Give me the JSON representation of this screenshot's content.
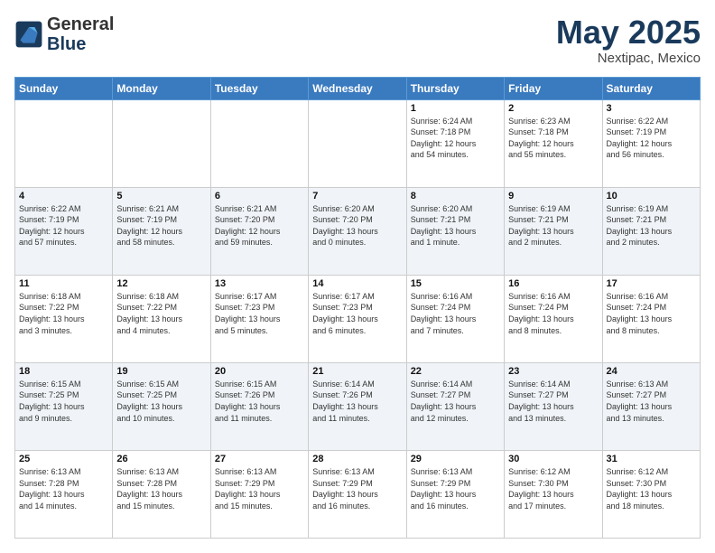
{
  "logo": {
    "line1": "General",
    "line2": "Blue"
  },
  "header": {
    "month": "May 2025",
    "location": "Nextipac, Mexico"
  },
  "days_of_week": [
    "Sunday",
    "Monday",
    "Tuesday",
    "Wednesday",
    "Thursday",
    "Friday",
    "Saturday"
  ],
  "weeks": [
    [
      {
        "day": "",
        "info": ""
      },
      {
        "day": "",
        "info": ""
      },
      {
        "day": "",
        "info": ""
      },
      {
        "day": "",
        "info": ""
      },
      {
        "day": "1",
        "info": "Sunrise: 6:24 AM\nSunset: 7:18 PM\nDaylight: 12 hours\nand 54 minutes."
      },
      {
        "day": "2",
        "info": "Sunrise: 6:23 AM\nSunset: 7:18 PM\nDaylight: 12 hours\nand 55 minutes."
      },
      {
        "day": "3",
        "info": "Sunrise: 6:22 AM\nSunset: 7:19 PM\nDaylight: 12 hours\nand 56 minutes."
      }
    ],
    [
      {
        "day": "4",
        "info": "Sunrise: 6:22 AM\nSunset: 7:19 PM\nDaylight: 12 hours\nand 57 minutes."
      },
      {
        "day": "5",
        "info": "Sunrise: 6:21 AM\nSunset: 7:19 PM\nDaylight: 12 hours\nand 58 minutes."
      },
      {
        "day": "6",
        "info": "Sunrise: 6:21 AM\nSunset: 7:20 PM\nDaylight: 12 hours\nand 59 minutes."
      },
      {
        "day": "7",
        "info": "Sunrise: 6:20 AM\nSunset: 7:20 PM\nDaylight: 13 hours\nand 0 minutes."
      },
      {
        "day": "8",
        "info": "Sunrise: 6:20 AM\nSunset: 7:21 PM\nDaylight: 13 hours\nand 1 minute."
      },
      {
        "day": "9",
        "info": "Sunrise: 6:19 AM\nSunset: 7:21 PM\nDaylight: 13 hours\nand 2 minutes."
      },
      {
        "day": "10",
        "info": "Sunrise: 6:19 AM\nSunset: 7:21 PM\nDaylight: 13 hours\nand 2 minutes."
      }
    ],
    [
      {
        "day": "11",
        "info": "Sunrise: 6:18 AM\nSunset: 7:22 PM\nDaylight: 13 hours\nand 3 minutes."
      },
      {
        "day": "12",
        "info": "Sunrise: 6:18 AM\nSunset: 7:22 PM\nDaylight: 13 hours\nand 4 minutes."
      },
      {
        "day": "13",
        "info": "Sunrise: 6:17 AM\nSunset: 7:23 PM\nDaylight: 13 hours\nand 5 minutes."
      },
      {
        "day": "14",
        "info": "Sunrise: 6:17 AM\nSunset: 7:23 PM\nDaylight: 13 hours\nand 6 minutes."
      },
      {
        "day": "15",
        "info": "Sunrise: 6:16 AM\nSunset: 7:24 PM\nDaylight: 13 hours\nand 7 minutes."
      },
      {
        "day": "16",
        "info": "Sunrise: 6:16 AM\nSunset: 7:24 PM\nDaylight: 13 hours\nand 8 minutes."
      },
      {
        "day": "17",
        "info": "Sunrise: 6:16 AM\nSunset: 7:24 PM\nDaylight: 13 hours\nand 8 minutes."
      }
    ],
    [
      {
        "day": "18",
        "info": "Sunrise: 6:15 AM\nSunset: 7:25 PM\nDaylight: 13 hours\nand 9 minutes."
      },
      {
        "day": "19",
        "info": "Sunrise: 6:15 AM\nSunset: 7:25 PM\nDaylight: 13 hours\nand 10 minutes."
      },
      {
        "day": "20",
        "info": "Sunrise: 6:15 AM\nSunset: 7:26 PM\nDaylight: 13 hours\nand 11 minutes."
      },
      {
        "day": "21",
        "info": "Sunrise: 6:14 AM\nSunset: 7:26 PM\nDaylight: 13 hours\nand 11 minutes."
      },
      {
        "day": "22",
        "info": "Sunrise: 6:14 AM\nSunset: 7:27 PM\nDaylight: 13 hours\nand 12 minutes."
      },
      {
        "day": "23",
        "info": "Sunrise: 6:14 AM\nSunset: 7:27 PM\nDaylight: 13 hours\nand 13 minutes."
      },
      {
        "day": "24",
        "info": "Sunrise: 6:13 AM\nSunset: 7:27 PM\nDaylight: 13 hours\nand 13 minutes."
      }
    ],
    [
      {
        "day": "25",
        "info": "Sunrise: 6:13 AM\nSunset: 7:28 PM\nDaylight: 13 hours\nand 14 minutes."
      },
      {
        "day": "26",
        "info": "Sunrise: 6:13 AM\nSunset: 7:28 PM\nDaylight: 13 hours\nand 15 minutes."
      },
      {
        "day": "27",
        "info": "Sunrise: 6:13 AM\nSunset: 7:29 PM\nDaylight: 13 hours\nand 15 minutes."
      },
      {
        "day": "28",
        "info": "Sunrise: 6:13 AM\nSunset: 7:29 PM\nDaylight: 13 hours\nand 16 minutes."
      },
      {
        "day": "29",
        "info": "Sunrise: 6:13 AM\nSunset: 7:29 PM\nDaylight: 13 hours\nand 16 minutes."
      },
      {
        "day": "30",
        "info": "Sunrise: 6:12 AM\nSunset: 7:30 PM\nDaylight: 13 hours\nand 17 minutes."
      },
      {
        "day": "31",
        "info": "Sunrise: 6:12 AM\nSunset: 7:30 PM\nDaylight: 13 hours\nand 18 minutes."
      }
    ]
  ]
}
